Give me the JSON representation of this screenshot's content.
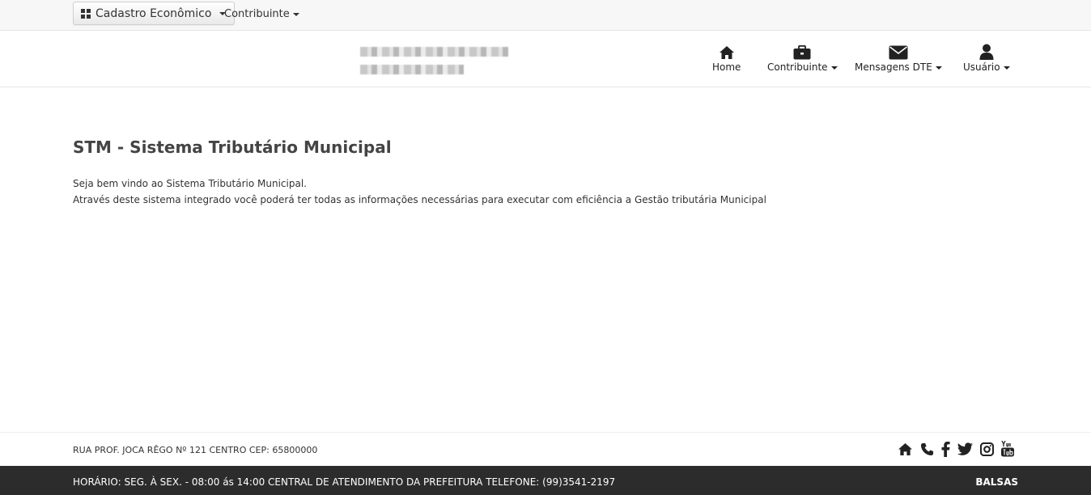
{
  "topbar": {
    "module_button": "Cadastro Econômico",
    "contribuinte_menu": "Contribuinte"
  },
  "nav": {
    "home": "Home",
    "contribuinte": "Contribuinte",
    "mensagens": "Mensagens DTE",
    "usuario": "Usuário"
  },
  "main": {
    "title": "STM - Sistema Tributário Municipal",
    "welcome": "Seja bem vindo ao Sistema Tributário Municipal.",
    "description": "Através deste sistema integrado você poderá ter todas as informações necessárias para executar com eficiência a Gestão tributária Municipal"
  },
  "footer": {
    "address": "RUA PROF. JOCA RÊGO Nº 121 CENTRO CEP: 65800000",
    "hours": "HORÁRIO: SEG. À SEX. - 08:00 ás 14:00 CENTRAL DE ATENDIMENTO DA PREFEITURA TELEFONE: (99)3541-2197",
    "city": "BALSAS",
    "social_icons": [
      "home-icon",
      "phone-icon",
      "facebook-icon",
      "twitter-icon",
      "instagram-icon",
      "youtube-icon"
    ]
  },
  "colors": {
    "footer_dark": "#2c2c2c",
    "topbar_bg": "#f7f7f7",
    "title_text": "#444444"
  }
}
